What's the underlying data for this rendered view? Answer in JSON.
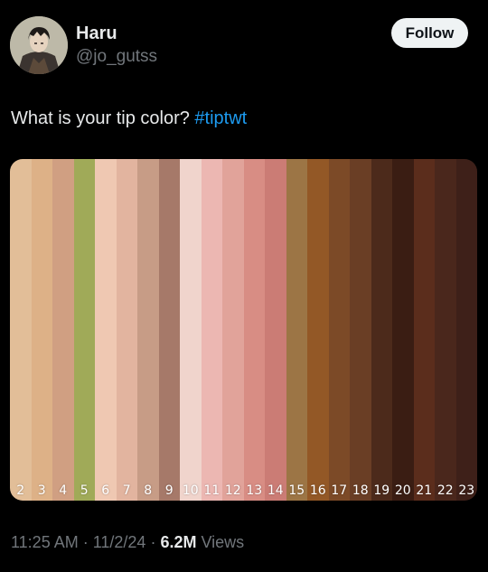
{
  "user": {
    "name": "Haru",
    "handle": "@jo_gutss",
    "follow_label": "Follow"
  },
  "tweet": {
    "text": "What is your tip color? ",
    "hashtag": "#tiptwt"
  },
  "palette": [
    {
      "label": "2",
      "color": "#e2be98"
    },
    {
      "label": "3",
      "color": "#ddb187"
    },
    {
      "label": "4",
      "color": "#d09f82"
    },
    {
      "label": "5",
      "color": "#a0aa58"
    },
    {
      "label": "6",
      "color": "#efc8b2"
    },
    {
      "label": "7",
      "color": "#e2b49f"
    },
    {
      "label": "8",
      "color": "#c79c86"
    },
    {
      "label": "9",
      "color": "#a67969"
    },
    {
      "label": "10",
      "color": "#f0d4cc"
    },
    {
      "label": "11",
      "color": "#ecb7b2"
    },
    {
      "label": "12",
      "color": "#e1a39a"
    },
    {
      "label": "13",
      "color": "#d88d84"
    },
    {
      "label": "14",
      "color": "#cb7c75"
    },
    {
      "label": "15",
      "color": "#9c7545"
    },
    {
      "label": "16",
      "color": "#935826"
    },
    {
      "label": "17",
      "color": "#7c4a27"
    },
    {
      "label": "18",
      "color": "#6a3e25"
    },
    {
      "label": "19",
      "color": "#4c2a1b"
    },
    {
      "label": "20",
      "color": "#3a1d13"
    },
    {
      "label": "21",
      "color": "#5b2d1c"
    },
    {
      "label": "22",
      "color": "#4a271c"
    },
    {
      "label": "23",
      "color": "#3e2019"
    }
  ],
  "meta": {
    "time": "11:25 AM",
    "separator": " · ",
    "date": "11/2/24",
    "views_count": "6.2M",
    "views_label": " Views"
  }
}
